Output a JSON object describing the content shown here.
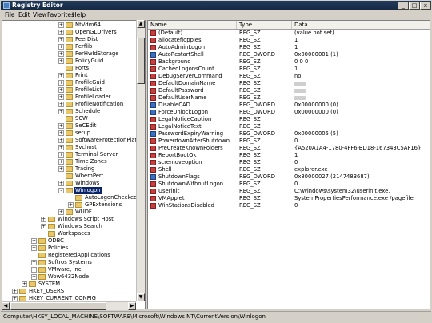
{
  "window": {
    "title": "Registry Editor",
    "controls": {
      "minimize": "_",
      "maximize": "□",
      "close": "x"
    }
  },
  "menu": [
    "File",
    "Edit",
    "View",
    "Favorites",
    "Help"
  ],
  "tree": [
    {
      "label": "NtVdm64",
      "expander": "+"
    },
    {
      "label": "OpenGLDrivers",
      "expander": "+"
    },
    {
      "label": "PeerDist",
      "expander": "+"
    },
    {
      "label": "Perflib",
      "expander": "+"
    },
    {
      "label": "PerHwIdStorage",
      "expander": "+"
    },
    {
      "label": "PolicyGuid",
      "expander": "+"
    },
    {
      "label": "Ports",
      "expander": ""
    },
    {
      "label": "Print",
      "expander": "+"
    },
    {
      "label": "ProfileGuid",
      "expander": "+"
    },
    {
      "label": "ProfileList",
      "expander": "+"
    },
    {
      "label": "ProfileLoader",
      "expander": "+"
    },
    {
      "label": "ProfileNotification",
      "expander": "+"
    },
    {
      "label": "Schedule",
      "expander": "+"
    },
    {
      "label": "SCW",
      "expander": ""
    },
    {
      "label": "SeCEdit",
      "expander": "+"
    },
    {
      "label": "setup",
      "expander": "+"
    },
    {
      "label": "SoftwareProtectionPlatform",
      "expander": "+"
    },
    {
      "label": "Svchost",
      "expander": "+"
    },
    {
      "label": "Terminal Server",
      "expander": "+"
    },
    {
      "label": "Time Zones",
      "expander": "+"
    },
    {
      "label": "Tracing",
      "expander": "+"
    },
    {
      "label": "WbemPerf",
      "expander": ""
    },
    {
      "label": "Windows",
      "expander": "+"
    },
    {
      "label": "Winlogon",
      "expander": "-",
      "selected": true
    },
    {
      "label": "AutoLogonChecked",
      "expander": ""
    },
    {
      "label": "GPExtensions",
      "expander": "+"
    },
    {
      "label": "WUDF",
      "expander": "+"
    },
    {
      "label": "Windows Script Host",
      "expander": "+"
    },
    {
      "label": "Windows Search",
      "expander": "+"
    },
    {
      "label": "Workspaces",
      "expander": ""
    },
    {
      "label": "ODBC",
      "expander": "+"
    },
    {
      "label": "Policies",
      "expander": "+"
    },
    {
      "label": "RegisteredApplications",
      "expander": ""
    },
    {
      "label": "Softros Systems",
      "expander": "+"
    },
    {
      "label": "VMware, Inc.",
      "expander": "+"
    },
    {
      "label": "Wow6432Node",
      "expander": "+"
    },
    {
      "label": "SYSTEM",
      "expander": "+"
    },
    {
      "label": "HKEY_USERS",
      "expander": "+"
    },
    {
      "label": "HKEY_CURRENT_CONFIG",
      "expander": "+"
    }
  ],
  "columns": [
    "Name",
    "Type",
    "Data"
  ],
  "values": [
    {
      "name": "(Default)",
      "type": "REG_SZ",
      "data": "(value not set)",
      "icon": "string-value-icon"
    },
    {
      "name": "allocatefloppies",
      "type": "REG_SZ",
      "data": "1",
      "icon": "string-value-icon"
    },
    {
      "name": "AutoAdminLogon",
      "type": "REG_SZ",
      "data": "1",
      "icon": "string-value-icon"
    },
    {
      "name": "AutoRestartShell",
      "type": "REG_DWORD",
      "data": "0x00000001 (1)",
      "icon": "dword-value-icon"
    },
    {
      "name": "Background",
      "type": "REG_SZ",
      "data": "0 0 0",
      "icon": "string-value-icon"
    },
    {
      "name": "CachedLogonsCount",
      "type": "REG_SZ",
      "data": "1",
      "icon": "string-value-icon"
    },
    {
      "name": "DebugServerCommand",
      "type": "REG_SZ",
      "data": "no",
      "icon": "string-value-icon"
    },
    {
      "name": "DefaultDomainName",
      "type": "REG_SZ",
      "data": "",
      "redacted": true,
      "icon": "string-value-icon"
    },
    {
      "name": "DefaultPassword",
      "type": "REG_SZ",
      "data": "",
      "redacted": true,
      "icon": "string-value-icon"
    },
    {
      "name": "DefaultUserName",
      "type": "REG_SZ",
      "data": "",
      "redacted": true,
      "icon": "string-value-icon"
    },
    {
      "name": "DisableCAD",
      "type": "REG_DWORD",
      "data": "0x00000000 (0)",
      "icon": "dword-value-icon"
    },
    {
      "name": "ForceUnlockLogon",
      "type": "REG_DWORD",
      "data": "0x00000000 (0)",
      "icon": "dword-value-icon"
    },
    {
      "name": "LegalNoticeCaption",
      "type": "REG_SZ",
      "data": "",
      "icon": "string-value-icon"
    },
    {
      "name": "LegalNoticeText",
      "type": "REG_SZ",
      "data": "",
      "icon": "string-value-icon"
    },
    {
      "name": "PasswordExpiryWarning",
      "type": "REG_DWORD",
      "data": "0x00000005 (5)",
      "icon": "dword-value-icon"
    },
    {
      "name": "PowerdownAfterShutdown",
      "type": "REG_SZ",
      "data": "0",
      "icon": "string-value-icon"
    },
    {
      "name": "PreCreateKnownFolders",
      "type": "REG_SZ",
      "data": "{A520A1A4-1780-4FF6-BD18-167343C5AF16}",
      "icon": "string-value-icon"
    },
    {
      "name": "ReportBootOk",
      "type": "REG_SZ",
      "data": "1",
      "icon": "string-value-icon"
    },
    {
      "name": "scremoveoption",
      "type": "REG_SZ",
      "data": "0",
      "icon": "string-value-icon"
    },
    {
      "name": "Shell",
      "type": "REG_SZ",
      "data": "explorer.exe",
      "icon": "string-value-icon"
    },
    {
      "name": "ShutdownFlags",
      "type": "REG_DWORD",
      "data": "0x80000027 (2147483687)",
      "icon": "dword-value-icon"
    },
    {
      "name": "ShutdownWithoutLogon",
      "type": "REG_SZ",
      "data": "0",
      "icon": "string-value-icon"
    },
    {
      "name": "Userinit",
      "type": "REG_SZ",
      "data": "C:\\Windows\\system32\\userinit.exe,",
      "icon": "string-value-icon"
    },
    {
      "name": "VMApplet",
      "type": "REG_SZ",
      "data": "SystemPropertiesPerformance.exe /pagefile",
      "icon": "string-value-icon"
    },
    {
      "name": "WinStationsDisabled",
      "type": "REG_SZ",
      "data": "0",
      "icon": "string-value-icon"
    }
  ],
  "status": "Computer\\HKEY_LOCAL_MACHINE\\SOFTWARE\\Microsoft\\Windows NT\\CurrentVersion\\Winlogon",
  "colors": {
    "title_bar": "#203a5e",
    "selection": "#0a246a",
    "string_icon": "#c34040",
    "dword_icon": "#3a6fc1"
  }
}
